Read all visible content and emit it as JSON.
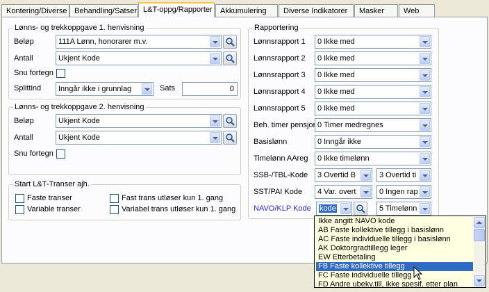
{
  "tabs": [
    "Kontering/Diverse",
    "Behandling/Satser",
    "L&T-oppg/Rapporter",
    "Akkumulering",
    "Diverse Indikatorer",
    "Masker",
    "Web"
  ],
  "group1": {
    "title": "Lønns- og trekkoppgave 1. henvisning",
    "belop_label": "Beløp",
    "belop_value": "111A Lønn, honorarer m.v.",
    "antall_label": "Antall",
    "antall_value": "Ukjent Kode",
    "snu_label": "Snu fortegn",
    "splittind_label": "Splittind",
    "splittind_value": "Inngår ikke i grunnlag",
    "sats_label": "Sats",
    "sats_value": "0"
  },
  "group2": {
    "title": "Lønns- og trekkoppgave 2. henvisning",
    "belop_label": "Beløp",
    "belop_value": "Ukjent Kode",
    "antall_label": "Antall",
    "antall_value": "Ukjent Kode",
    "snu_label": "Snu fortegn"
  },
  "group3": {
    "title": "Start L&T-Transer ajh.",
    "faste": "Faste transer",
    "variable": "Variable transer",
    "fast_utloser": "Fast trans utløser kun 1. gang",
    "variabel_utloser": "Variabel trans utløser kun 1. gang"
  },
  "rapportering": {
    "title": "Rapportering",
    "rows": [
      {
        "label": "Lønnsrapport 1",
        "value": "0 Ikke med"
      },
      {
        "label": "Lønnsrapport 2",
        "value": "0 Ikke med"
      },
      {
        "label": "Lønnsrapport 3",
        "value": "0 Ikke med"
      },
      {
        "label": "Lønnsrapport 4",
        "value": "0 Ikke med"
      },
      {
        "label": "Lønnsrapport 5",
        "value": "0 Ikke med"
      },
      {
        "label": "Beh. timer pensjon",
        "value": "0 Timer medregnes"
      },
      {
        "label": "Basislønn",
        "value": "0 Inngår ikke"
      },
      {
        "label": "Timelønn AAreg",
        "value": "0 Ikke timelønn"
      }
    ],
    "ssb_label": "SSB-/TBL-Kode",
    "ssb_value1": "3 Overtid B",
    "ssb_value2": "3 Overtid ti",
    "sst_label": "SST/PAI Kode",
    "sst_value1": "4 Var. overt",
    "sst_value2": "0 Ingen rap",
    "navo_label": "NAVO/KLP Kode",
    "navo_value": "kode",
    "navo_value2": "5 Timelønn"
  },
  "dropdown_items": [
    "Ikke angitt NAVO kode",
    "AB Faste kollektive tillegg i basislønn",
    "AC Faste individuelle tillegg i basislønn",
    "AK Doktorgradtillegg leger",
    "EW Etterbetaling",
    "FB Faste kollektive tillegg",
    "FC Faste individuelle tillegg",
    "FD Andre ubekv.till, ikke spesif. etter plan"
  ],
  "colors": {
    "accent": "#316ac5",
    "tab_highlight": "#ffc83c",
    "link_label": "#2a2ad0"
  }
}
